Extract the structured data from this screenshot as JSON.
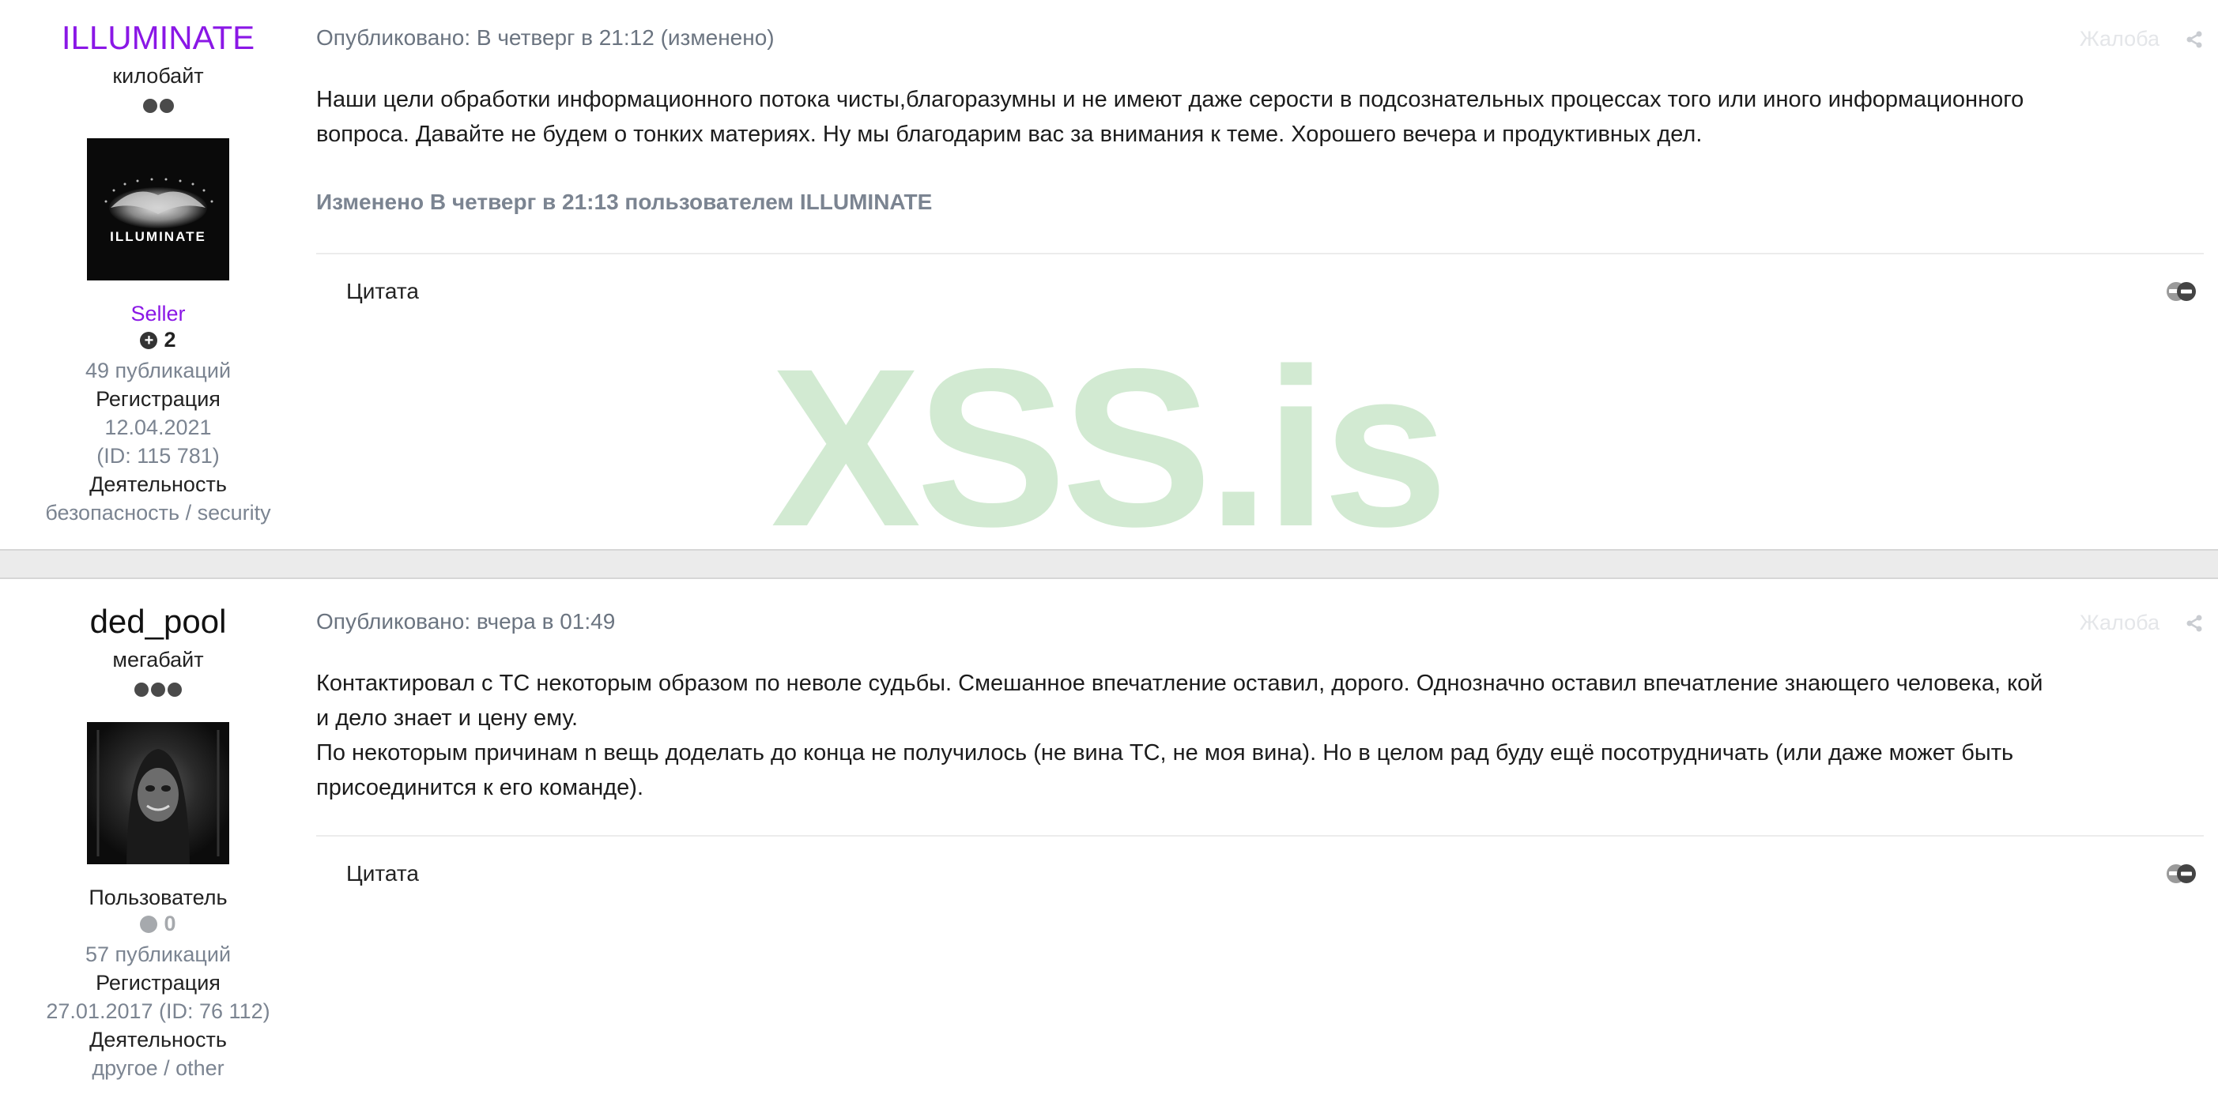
{
  "posts": [
    {
      "author": {
        "name": "ILLUMINATE",
        "rank": "килобайт",
        "pips": 2,
        "avatar_text": "ILLUMINATE",
        "group": "Seller",
        "reputation": "2",
        "posts_count": "49 публикаций",
        "reg_label": "Регистрация",
        "reg_date": "12.04.2021",
        "reg_id": "(ID: 115 781)",
        "activity_label": "Деятельность",
        "activity_value": "безопасность / security"
      },
      "meta": "Опубликовано: В четверг в 21:12 (изменено)",
      "report": "Жалоба",
      "content": [
        "Наши цели обработки информационного потока чисты,благоразумны и не имеют даже серости в подсознательных процессах того или иного информационного",
        "вопроса. Давайте не будем о тонких материях. Ну мы благодарим вас за внимания к теме. Хорошего вечера и продуктивных дел."
      ],
      "edited": "Изменено В четверг в 21:13 пользователем ILLUMINATE",
      "quote": "Цитата"
    },
    {
      "author": {
        "name": "ded_pool",
        "rank": "мегабайт",
        "pips": 3,
        "group": "Пользователь",
        "reputation": "0",
        "posts_count": "57 публикаций",
        "reg_label": "Регистрация",
        "reg_line": "27.01.2017 (ID: 76 112)",
        "activity_label": "Деятельность",
        "activity_value": "другое / other"
      },
      "meta": "Опубликовано: вчера в 01:49",
      "report": "Жалоба",
      "content": [
        "Контактировал с ТС некоторым образом по неволе судьбы. Смешанное впечатление оставил, дорого. Однозначно оставил впечатление знающего человека, кой",
        "и дело знает и цену ему.",
        "По некоторым причинам n вещь доделать до конца не получилось (не вина ТС, не моя вина). Но в целом рад буду ещё посотрудничать (или даже может быть",
        "присоединится к его команде)."
      ],
      "quote": "Цитата"
    }
  ],
  "watermark": "XSS.is",
  "colors": {
    "accent_purple": "#8a17e6",
    "muted": "#7b8491",
    "watermark": "#d2ead2"
  }
}
